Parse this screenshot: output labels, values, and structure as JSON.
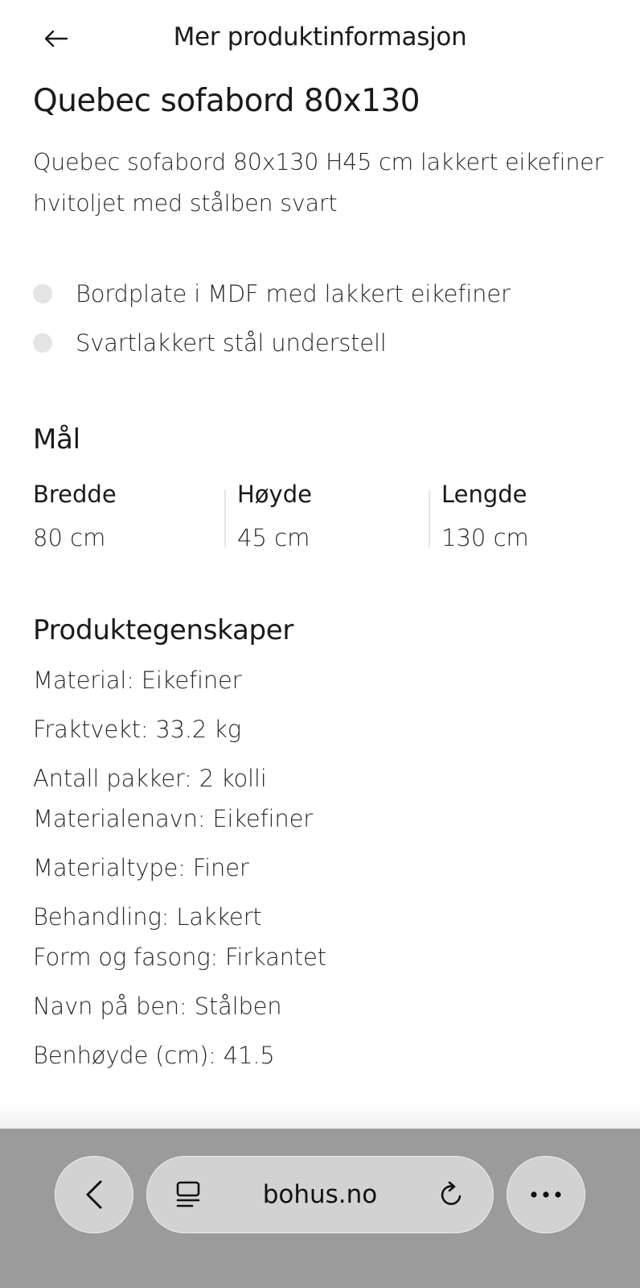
{
  "header": {
    "title": "Mer produktinformasjon",
    "back_icon": "arrow-left-icon"
  },
  "product": {
    "title": "Quebec sofabord 80x130",
    "description": "Quebec sofabord 80x130 H45 cm lakkert eikefiner hvitoljet med stålben svart",
    "bullets": [
      "Bordplate i MDF med lakkert eikefiner",
      "Svartlakkert stål understell"
    ]
  },
  "dimensions": {
    "title": "Mål",
    "items": [
      {
        "label": "Bredde",
        "value": "80 cm"
      },
      {
        "label": "Høyde",
        "value": "45 cm"
      },
      {
        "label": "Lengde",
        "value": "130 cm"
      }
    ]
  },
  "properties": {
    "title": "Produktegenskaper",
    "items": [
      "Material: Eikefiner",
      "Fraktvekt: 33.2 kg",
      "Antall pakker: 2 kolli",
      "Materialenavn: Eikefiner",
      "Materialtype: Finer",
      "Behandling: Lakkert",
      "Form og fasong: Firkantet",
      "Navn på ben: Stålben",
      "Benhøyde (cm): 41.5"
    ]
  },
  "browser": {
    "url": "bohus.no",
    "back_icon": "chevron-left-icon",
    "tabs_icon": "page-layout-icon",
    "reload_icon": "reload-icon",
    "more_icon": "ellipsis-icon",
    "bar_color": "#9b9b9b"
  }
}
